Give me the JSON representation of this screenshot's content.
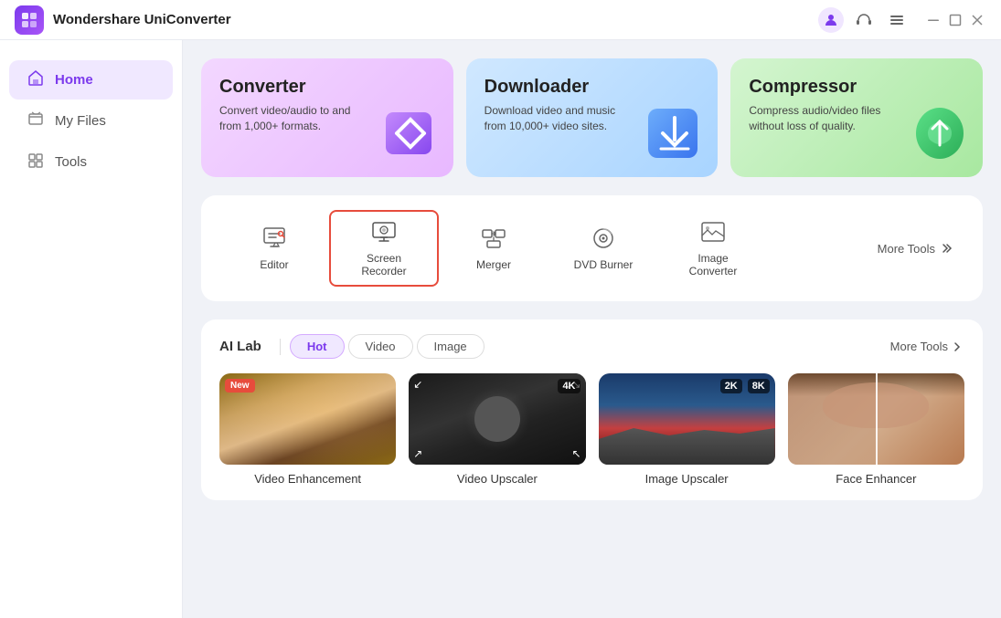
{
  "app": {
    "name": "Wondershare",
    "product": "UniConverter",
    "logo_letter": "U"
  },
  "titlebar": {
    "user_icon": "👤",
    "headset_icon": "🎧",
    "menu_icon": "☰",
    "minimize": "—",
    "maximize": "☐",
    "close": "✕"
  },
  "sidebar": {
    "items": [
      {
        "id": "home",
        "label": "Home",
        "icon": "⌂",
        "active": true
      },
      {
        "id": "my-files",
        "label": "My Files",
        "icon": "📁",
        "active": false
      },
      {
        "id": "tools",
        "label": "Tools",
        "icon": "🔧",
        "active": false
      }
    ]
  },
  "feature_cards": [
    {
      "id": "converter",
      "title": "Converter",
      "desc": "Convert video/audio to and from 1,000+ formats.",
      "theme": "converter"
    },
    {
      "id": "downloader",
      "title": "Downloader",
      "desc": "Download video and music from 10,000+ video sites.",
      "theme": "downloader"
    },
    {
      "id": "compressor",
      "title": "Compressor",
      "desc": "Compress audio/video files without loss of quality.",
      "theme": "compressor"
    }
  ],
  "tools": [
    {
      "id": "editor",
      "label": "Editor",
      "selected": false
    },
    {
      "id": "screen-recorder",
      "label": "Screen Recorder",
      "selected": true
    },
    {
      "id": "merger",
      "label": "Merger",
      "selected": false
    },
    {
      "id": "dvd-burner",
      "label": "DVD Burner",
      "selected": false
    },
    {
      "id": "image-converter",
      "label": "Image Converter",
      "selected": false
    }
  ],
  "more_tools": "More Tools",
  "ai_lab": {
    "label": "AI Lab",
    "tabs": [
      {
        "id": "hot",
        "label": "Hot",
        "active": true
      },
      {
        "id": "video",
        "label": "Video",
        "active": false
      },
      {
        "id": "image",
        "label": "Image",
        "active": false
      }
    ],
    "more_tools_label": "More Tools",
    "cards": [
      {
        "id": "video-enhancement",
        "label": "Video Enhancement",
        "new_badge": true,
        "res_badge": null,
        "thumb_type": "dog"
      },
      {
        "id": "video-upscaler",
        "label": "Video Upscaler",
        "new_badge": false,
        "res_badge": "4K",
        "thumb_type": "food"
      },
      {
        "id": "image-upscaler",
        "label": "Image Upscaler",
        "new_badge": false,
        "res_badge": "8K",
        "thumb_type": "fjord"
      },
      {
        "id": "face-enhancer",
        "label": "Face Enhancer",
        "new_badge": false,
        "res_badge": null,
        "thumb_type": "face"
      }
    ]
  }
}
